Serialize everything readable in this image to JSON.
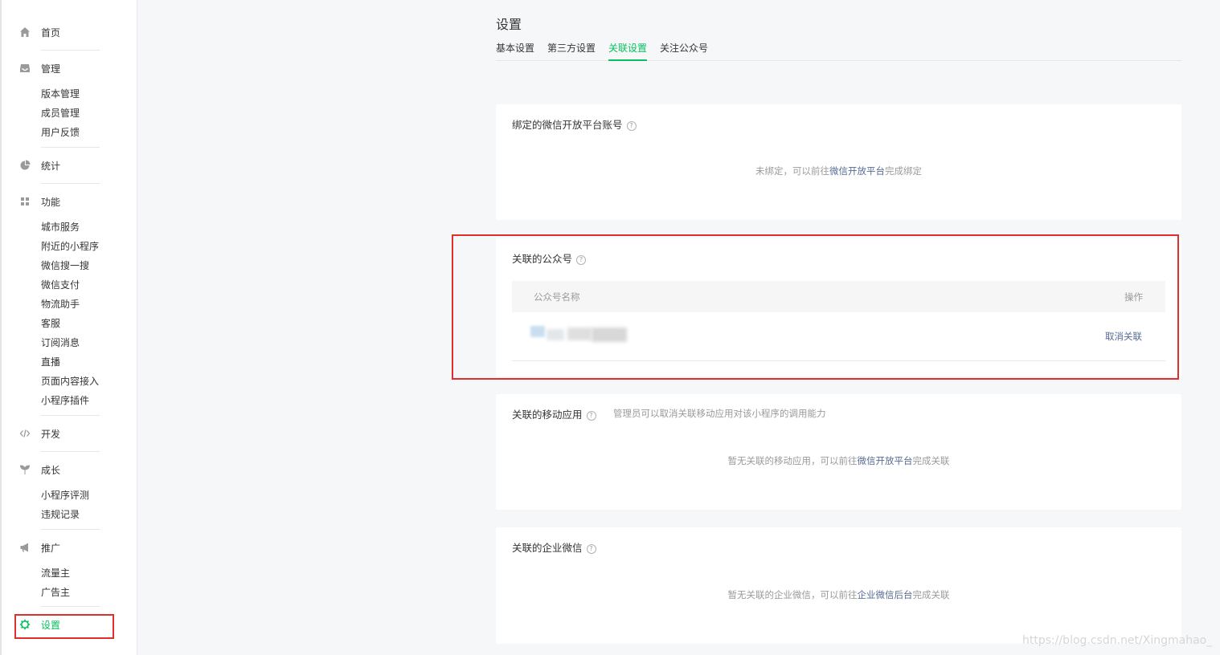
{
  "sidebar": {
    "home": "首页",
    "manage": {
      "label": "管理",
      "items": [
        "版本管理",
        "成员管理",
        "用户反馈"
      ]
    },
    "stats": "统计",
    "features": {
      "label": "功能",
      "items": [
        "城市服务",
        "附近的小程序",
        "微信搜一搜",
        "微信支付",
        "物流助手",
        "客服",
        "订阅消息",
        "直播",
        "页面内容接入",
        "小程序插件"
      ]
    },
    "dev": "开发",
    "growth": {
      "label": "成长",
      "items": [
        "小程序评测",
        "违规记录"
      ]
    },
    "promo": {
      "label": "推广",
      "items": [
        "流量主",
        "广告主"
      ]
    },
    "settings": "设置",
    "active_color": "#07c160"
  },
  "page": {
    "title": "设置",
    "tabs": [
      "基本设置",
      "第三方设置",
      "关联设置",
      "关注公众号"
    ],
    "active_tab": "关联设置"
  },
  "cards": {
    "open_platform": {
      "title": "绑定的微信开放平台账号",
      "tip_prefix": "未绑定，可以前往",
      "tip_link": "微信开放平台",
      "tip_suffix": "完成绑定"
    },
    "official_accounts": {
      "title": "关联的公众号",
      "col_name": "公众号名称",
      "col_action": "操作",
      "row_action": "取消关联"
    },
    "mobile_apps": {
      "title": "关联的移动应用",
      "subtitle": "管理员可以取消关联移动应用对该小程序的调用能力",
      "tip_prefix": "暂无关联的移动应用，可以前往",
      "tip_link": "微信开放平台",
      "tip_suffix": "完成关联"
    },
    "work_wechat": {
      "title": "关联的企业微信",
      "tip_prefix": "暂无关联的企业微信，可以前往",
      "tip_link": "企业微信后台",
      "tip_suffix": "完成关联"
    }
  },
  "help_glyph": "?",
  "watermark": "https://blog.csdn.net/Xingmahao_"
}
